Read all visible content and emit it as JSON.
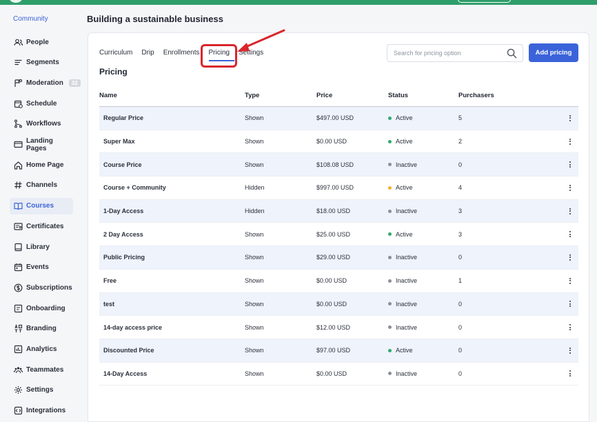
{
  "sidebar": {
    "title": "Community",
    "items": [
      {
        "label": "People",
        "icon": "people-icon"
      },
      {
        "label": "Segments",
        "icon": "segments-icon"
      },
      {
        "label": "Moderation",
        "icon": "moderation-icon",
        "badge": "32"
      },
      {
        "label": "Schedule",
        "icon": "schedule-icon"
      },
      {
        "label": "Workflows",
        "icon": "workflows-icon"
      },
      {
        "label": "Landing Pages",
        "icon": "landing-pages-icon"
      },
      {
        "label": "Home Page",
        "icon": "home-icon"
      },
      {
        "label": "Channels",
        "icon": "hash-icon"
      },
      {
        "label": "Courses",
        "icon": "book-icon",
        "active": true
      },
      {
        "label": "Certificates",
        "icon": "certificate-icon"
      },
      {
        "label": "Library",
        "icon": "library-icon"
      },
      {
        "label": "Events",
        "icon": "calendar-icon"
      },
      {
        "label": "Subscriptions",
        "icon": "dollar-icon"
      },
      {
        "label": "Onboarding",
        "icon": "onboarding-icon"
      },
      {
        "label": "Branding",
        "icon": "branding-icon"
      },
      {
        "label": "Analytics",
        "icon": "analytics-icon"
      },
      {
        "label": "Teammates",
        "icon": "teammates-icon"
      },
      {
        "label": "Settings",
        "icon": "gear-icon"
      },
      {
        "label": "Integrations",
        "icon": "integrations-icon"
      }
    ]
  },
  "page": {
    "title": "Building a sustainable business"
  },
  "tabs": [
    {
      "label": "Curriculum"
    },
    {
      "label": "Drip"
    },
    {
      "label": "Enrollments"
    },
    {
      "label": "Pricing",
      "active": true
    },
    {
      "label": "Settings"
    }
  ],
  "search": {
    "placeholder": "Search for pricing option"
  },
  "add_button": {
    "label": "Add pricing"
  },
  "section": {
    "title": "Pricing"
  },
  "table": {
    "headers": {
      "name": "Name",
      "type": "Type",
      "price": "Price",
      "status": "Status",
      "purchasers": "Purchasers"
    },
    "rows": [
      {
        "name": "Regular Price",
        "type": "Shown",
        "price": "$497.00 USD",
        "status": "Active",
        "status_color": "#2eaa6e",
        "purchasers": "5"
      },
      {
        "name": "Super Max",
        "type": "Shown",
        "price": "$0.00 USD",
        "status": "Active",
        "status_color": "#2eaa6e",
        "purchasers": "2"
      },
      {
        "name": "Course Price",
        "type": "Shown",
        "price": "$108.08 USD",
        "status": "Inactive",
        "status_color": "#8a8f99",
        "purchasers": "0"
      },
      {
        "name": "Course + Community",
        "type": "Hidden",
        "price": "$997.00 USD",
        "status": "Active",
        "status_color": "#f0b429",
        "purchasers": "4"
      },
      {
        "name": "1-Day Access",
        "type": "Hidden",
        "price": "$18.00 USD",
        "status": "Inactive",
        "status_color": "#8a8f99",
        "purchasers": "3"
      },
      {
        "name": "2 Day Access",
        "type": "Shown",
        "price": "$25.00 USD",
        "status": "Active",
        "status_color": "#2eaa6e",
        "purchasers": "3"
      },
      {
        "name": "Public Pricing",
        "type": "Shown",
        "price": "$29.00 USD",
        "status": "Inactive",
        "status_color": "#8a8f99",
        "purchasers": "0"
      },
      {
        "name": "Free",
        "type": "Shown",
        "price": "$0.00 USD",
        "status": "Inactive",
        "status_color": "#8a8f99",
        "purchasers": "1"
      },
      {
        "name": "test",
        "type": "Shown",
        "price": "$0.00 USD",
        "status": "Inactive",
        "status_color": "#8a8f99",
        "purchasers": "0"
      },
      {
        "name": "14-day access price",
        "type": "Shown",
        "price": "$12.00 USD",
        "status": "Inactive",
        "status_color": "#8a8f99",
        "purchasers": "0"
      },
      {
        "name": "Discounted Price",
        "type": "Shown",
        "price": "$97.00 USD",
        "status": "Active",
        "status_color": "#2eaa6e",
        "purchasers": "0"
      },
      {
        "name": "14-Day Access",
        "type": "Shown",
        "price": "$0.00 USD",
        "status": "Inactive",
        "status_color": "#8a8f99",
        "purchasers": "0"
      }
    ]
  },
  "colors": {
    "accent": "#3b63d9",
    "topbar": "#2e9e6b",
    "annotation": "#d8262c",
    "row_alt": "#eef3fc"
  }
}
